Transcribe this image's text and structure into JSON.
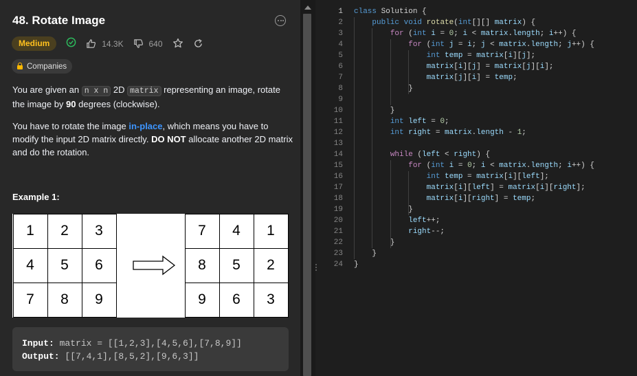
{
  "problem": {
    "title": "48. Rotate Image",
    "difficulty": "Medium",
    "likes": "14.3K",
    "dislikes": "640",
    "companies_label": "Companies",
    "description_p1": {
      "t1": "You are given an ",
      "code1": "n x n",
      "t2": " 2D ",
      "code2": "matrix",
      "t3": " representing an image, rotate the image by ",
      "bold": "90",
      "t4": " degrees (clockwise)."
    },
    "description_p2": {
      "t1": "You have to rotate the image ",
      "link": "in-place",
      "t2": ", which means you have to modify the input 2D matrix directly. ",
      "bold": "DO NOT",
      "t3": " allocate another 2D matrix and do the rotation."
    },
    "example_title": "Example 1:",
    "example_grid_before": [
      "1",
      "2",
      "3",
      "4",
      "5",
      "6",
      "7",
      "8",
      "9"
    ],
    "example_grid_after": [
      "7",
      "4",
      "1",
      "8",
      "5",
      "2",
      "9",
      "6",
      "3"
    ],
    "example_input_label": "Input:",
    "example_input": " matrix = [[1,2,3],[4,5,6],[7,8,9]]",
    "example_output_label": "Output:",
    "example_output": " [[7,4,1],[8,5,2],[9,6,3]]"
  },
  "editor": {
    "active_line": 1,
    "lines": [
      [
        [
          "kw",
          "class "
        ],
        [
          "plain",
          "Solution {"
        ]
      ],
      [
        [
          "plain",
          "    "
        ],
        [
          "kw",
          "public "
        ],
        [
          "ty",
          "void "
        ],
        [
          "fn",
          "rotate"
        ],
        [
          "plain",
          "("
        ],
        [
          "ty",
          "int"
        ],
        [
          "plain",
          "[][] "
        ],
        [
          "var",
          "matrix"
        ],
        [
          "plain",
          ") {"
        ]
      ],
      [
        [
          "plain",
          "        "
        ],
        [
          "ctl",
          "for "
        ],
        [
          "plain",
          "("
        ],
        [
          "ty",
          "int "
        ],
        [
          "var",
          "i"
        ],
        [
          "plain",
          " = "
        ],
        [
          "num",
          "0"
        ],
        [
          "plain",
          "; "
        ],
        [
          "var",
          "i"
        ],
        [
          "plain",
          " < "
        ],
        [
          "var",
          "matrix"
        ],
        [
          "plain",
          "."
        ],
        [
          "var",
          "length"
        ],
        [
          "plain",
          "; "
        ],
        [
          "var",
          "i"
        ],
        [
          "plain",
          "++) {"
        ]
      ],
      [
        [
          "plain",
          "            "
        ],
        [
          "ctl",
          "for "
        ],
        [
          "plain",
          "("
        ],
        [
          "ty",
          "int "
        ],
        [
          "var",
          "j"
        ],
        [
          "plain",
          " = "
        ],
        [
          "var",
          "i"
        ],
        [
          "plain",
          "; "
        ],
        [
          "var",
          "j"
        ],
        [
          "plain",
          " < "
        ],
        [
          "var",
          "matrix"
        ],
        [
          "plain",
          "."
        ],
        [
          "var",
          "length"
        ],
        [
          "plain",
          "; "
        ],
        [
          "var",
          "j"
        ],
        [
          "plain",
          "++) {"
        ]
      ],
      [
        [
          "plain",
          "                "
        ],
        [
          "ty",
          "int "
        ],
        [
          "var",
          "temp"
        ],
        [
          "plain",
          " = "
        ],
        [
          "var",
          "matrix"
        ],
        [
          "plain",
          "["
        ],
        [
          "var",
          "i"
        ],
        [
          "plain",
          "]["
        ],
        [
          "var",
          "j"
        ],
        [
          "plain",
          "];"
        ]
      ],
      [
        [
          "plain",
          "                "
        ],
        [
          "var",
          "matrix"
        ],
        [
          "plain",
          "["
        ],
        [
          "var",
          "i"
        ],
        [
          "plain",
          "]["
        ],
        [
          "var",
          "j"
        ],
        [
          "plain",
          "] = "
        ],
        [
          "var",
          "matrix"
        ],
        [
          "plain",
          "["
        ],
        [
          "var",
          "j"
        ],
        [
          "plain",
          "]["
        ],
        [
          "var",
          "i"
        ],
        [
          "plain",
          "];"
        ]
      ],
      [
        [
          "plain",
          "                "
        ],
        [
          "var",
          "matrix"
        ],
        [
          "plain",
          "["
        ],
        [
          "var",
          "j"
        ],
        [
          "plain",
          "]["
        ],
        [
          "var",
          "i"
        ],
        [
          "plain",
          "] = "
        ],
        [
          "var",
          "temp"
        ],
        [
          "plain",
          ";"
        ]
      ],
      [
        [
          "plain",
          "            }"
        ]
      ],
      [
        [
          "plain",
          ""
        ]
      ],
      [
        [
          "plain",
          "        }"
        ]
      ],
      [
        [
          "plain",
          "        "
        ],
        [
          "ty",
          "int "
        ],
        [
          "var",
          "left"
        ],
        [
          "plain",
          " = "
        ],
        [
          "num",
          "0"
        ],
        [
          "plain",
          ";"
        ]
      ],
      [
        [
          "plain",
          "        "
        ],
        [
          "ty",
          "int "
        ],
        [
          "var",
          "right"
        ],
        [
          "plain",
          " = "
        ],
        [
          "var",
          "matrix"
        ],
        [
          "plain",
          "."
        ],
        [
          "var",
          "length"
        ],
        [
          "plain",
          " - "
        ],
        [
          "num",
          "1"
        ],
        [
          "plain",
          ";"
        ]
      ],
      [
        [
          "plain",
          ""
        ]
      ],
      [
        [
          "plain",
          "        "
        ],
        [
          "ctl",
          "while "
        ],
        [
          "plain",
          "("
        ],
        [
          "var",
          "left"
        ],
        [
          "plain",
          " < "
        ],
        [
          "var",
          "right"
        ],
        [
          "plain",
          ") {"
        ]
      ],
      [
        [
          "plain",
          "            "
        ],
        [
          "ctl",
          "for "
        ],
        [
          "plain",
          "("
        ],
        [
          "ty",
          "int "
        ],
        [
          "var",
          "i"
        ],
        [
          "plain",
          " = "
        ],
        [
          "num",
          "0"
        ],
        [
          "plain",
          "; "
        ],
        [
          "var",
          "i"
        ],
        [
          "plain",
          " < "
        ],
        [
          "var",
          "matrix"
        ],
        [
          "plain",
          "."
        ],
        [
          "var",
          "length"
        ],
        [
          "plain",
          "; "
        ],
        [
          "var",
          "i"
        ],
        [
          "plain",
          "++) {"
        ]
      ],
      [
        [
          "plain",
          "                "
        ],
        [
          "ty",
          "int "
        ],
        [
          "var",
          "temp"
        ],
        [
          "plain",
          " = "
        ],
        [
          "var",
          "matrix"
        ],
        [
          "plain",
          "["
        ],
        [
          "var",
          "i"
        ],
        [
          "plain",
          "]["
        ],
        [
          "var",
          "left"
        ],
        [
          "plain",
          "];"
        ]
      ],
      [
        [
          "plain",
          "                "
        ],
        [
          "var",
          "matrix"
        ],
        [
          "plain",
          "["
        ],
        [
          "var",
          "i"
        ],
        [
          "plain",
          "]["
        ],
        [
          "var",
          "left"
        ],
        [
          "plain",
          "] = "
        ],
        [
          "var",
          "matrix"
        ],
        [
          "plain",
          "["
        ],
        [
          "var",
          "i"
        ],
        [
          "plain",
          "]["
        ],
        [
          "var",
          "right"
        ],
        [
          "plain",
          "];"
        ]
      ],
      [
        [
          "plain",
          "                "
        ],
        [
          "var",
          "matrix"
        ],
        [
          "plain",
          "["
        ],
        [
          "var",
          "i"
        ],
        [
          "plain",
          "]["
        ],
        [
          "var",
          "right"
        ],
        [
          "plain",
          "] = "
        ],
        [
          "var",
          "temp"
        ],
        [
          "plain",
          ";"
        ]
      ],
      [
        [
          "plain",
          "            }"
        ]
      ],
      [
        [
          "plain",
          "            "
        ],
        [
          "var",
          "left"
        ],
        [
          "plain",
          "++;"
        ]
      ],
      [
        [
          "plain",
          "            "
        ],
        [
          "var",
          "right"
        ],
        [
          "plain",
          "--;"
        ]
      ],
      [
        [
          "plain",
          "        }"
        ]
      ],
      [
        [
          "plain",
          "    }"
        ]
      ],
      [
        [
          "plain",
          "}"
        ]
      ]
    ]
  },
  "colors": {
    "difficulty_medium": "#ffc01e",
    "solved_green": "#2cbb5d",
    "link_blue": "#3d95ff"
  }
}
